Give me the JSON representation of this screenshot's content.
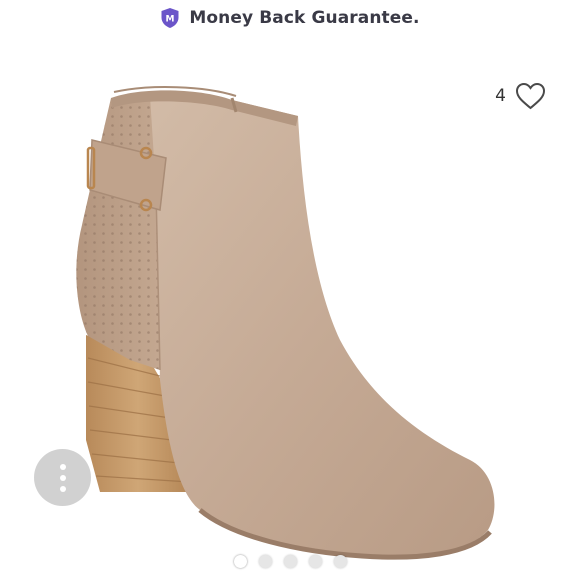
{
  "banner": {
    "text": "Money Back Guarantee.",
    "badge_letter": "M",
    "badge_color": "#6b55c9",
    "text_color": "#3a3a46"
  },
  "likes": {
    "count": "4",
    "icon": "heart-outline-icon"
  },
  "menu": {
    "icon": "more-vertical-icon"
  },
  "carousel": {
    "total": 5,
    "active_index": 0
  },
  "colors": {
    "suede": "#c5aa95",
    "heel_wood": "#c29a6c",
    "hardware_gold": "#b9864f"
  }
}
